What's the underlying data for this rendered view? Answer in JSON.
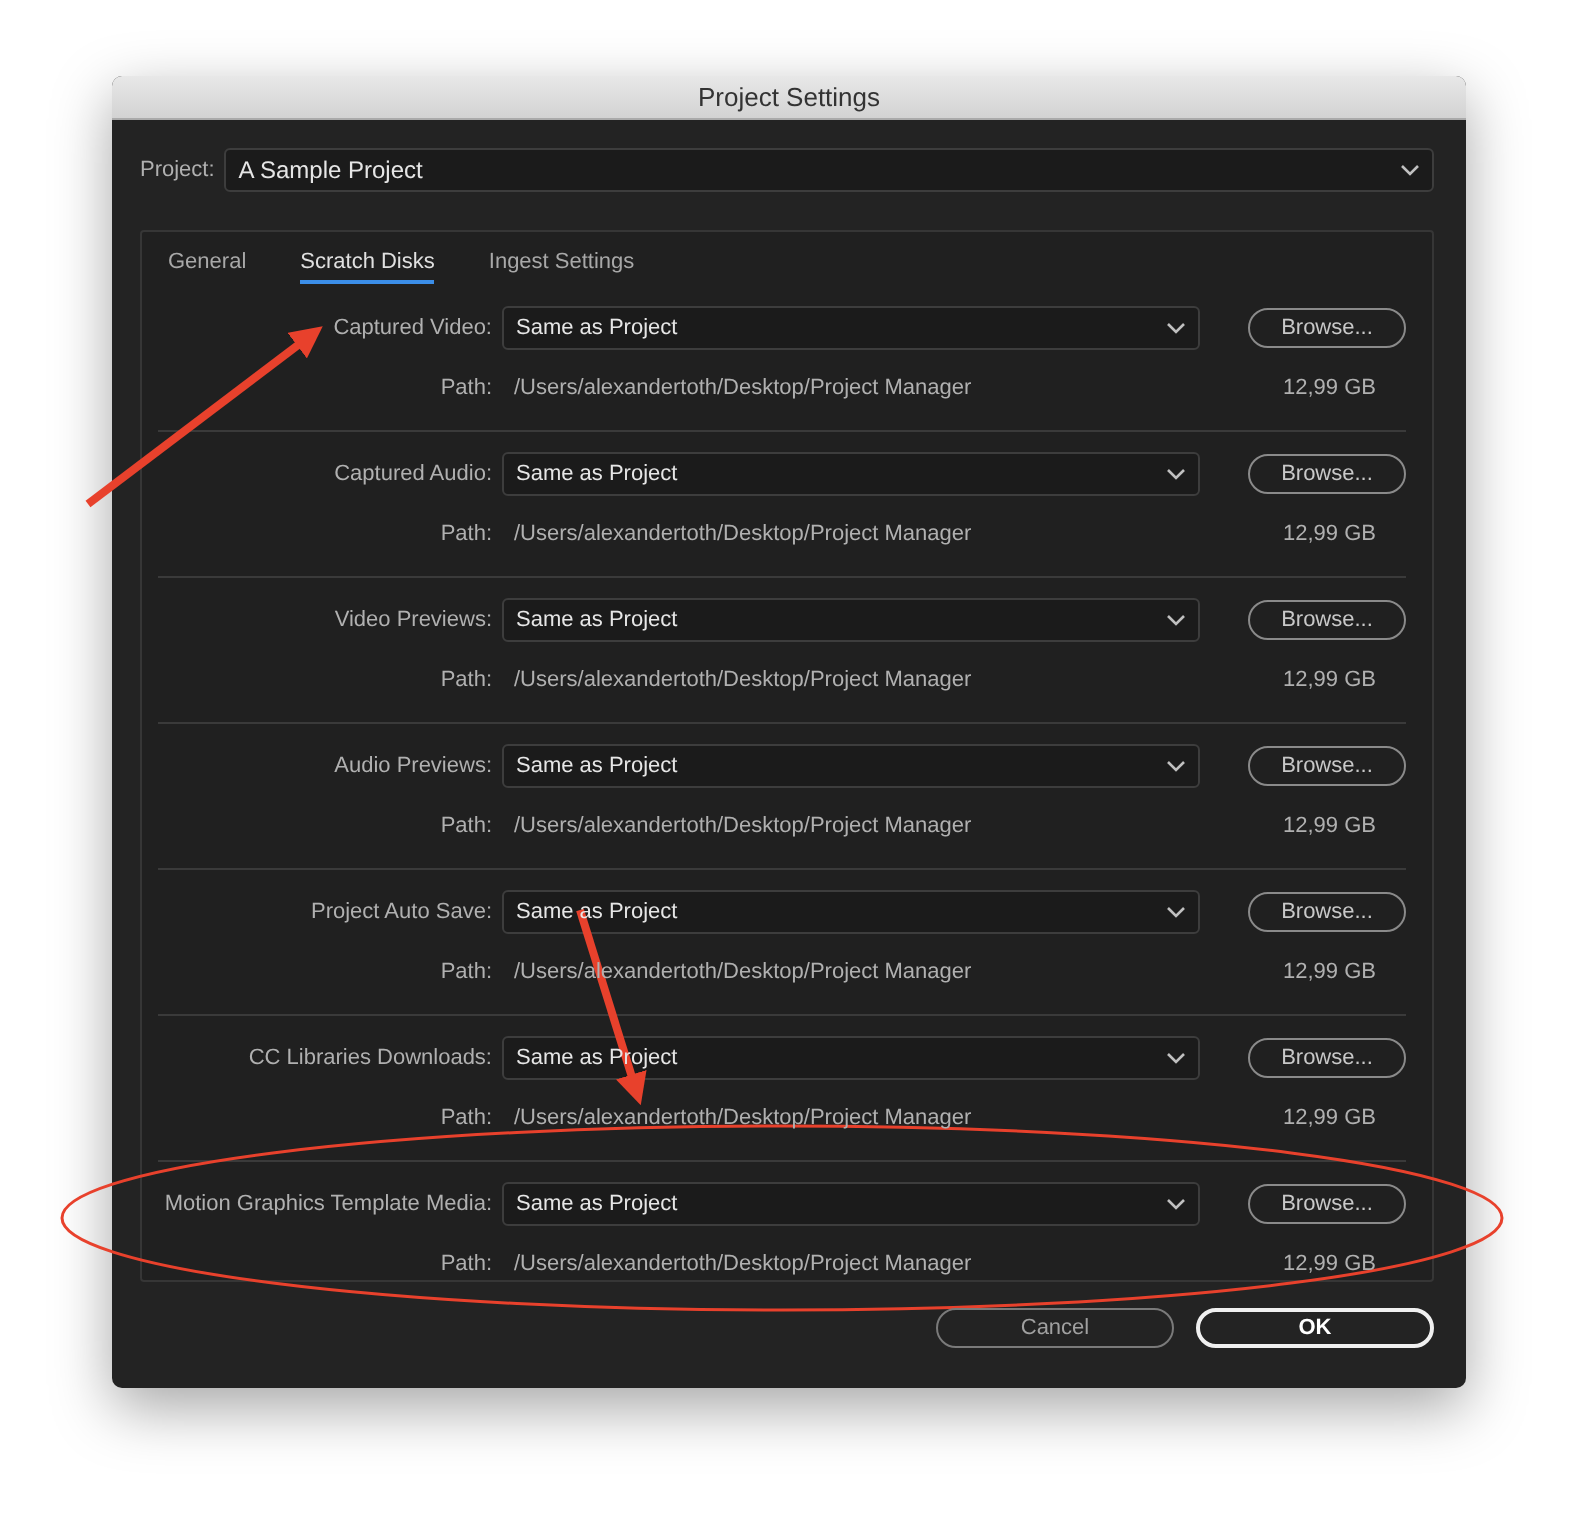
{
  "window": {
    "title": "Project Settings"
  },
  "project": {
    "label": "Project:",
    "value": "A Sample Project"
  },
  "tabs": [
    {
      "label": "General",
      "selected": false
    },
    {
      "label": "Scratch Disks",
      "selected": true
    },
    {
      "label": "Ingest Settings",
      "selected": false
    }
  ],
  "rows": [
    {
      "label": "Captured Video:",
      "value": "Same as Project",
      "button": "Browse...",
      "path_label": "Path:",
      "path": "/Users/alexandertoth/Desktop/Project Manager",
      "size": "12,99 GB"
    },
    {
      "label": "Captured Audio:",
      "value": "Same as Project",
      "button": "Browse...",
      "path_label": "Path:",
      "path": "/Users/alexandertoth/Desktop/Project Manager",
      "size": "12,99 GB"
    },
    {
      "label": "Video Previews:",
      "value": "Same as Project",
      "button": "Browse...",
      "path_label": "Path:",
      "path": "/Users/alexandertoth/Desktop/Project Manager",
      "size": "12,99 GB"
    },
    {
      "label": "Audio Previews:",
      "value": "Same as Project",
      "button": "Browse...",
      "path_label": "Path:",
      "path": "/Users/alexandertoth/Desktop/Project Manager",
      "size": "12,99 GB"
    },
    {
      "label": "Project Auto Save:",
      "value": "Same as Project",
      "button": "Browse...",
      "path_label": "Path:",
      "path": "/Users/alexandertoth/Desktop/Project Manager",
      "size": "12,99 GB"
    },
    {
      "label": "CC Libraries Downloads:",
      "value": "Same as Project",
      "button": "Browse...",
      "path_label": "Path:",
      "path": "/Users/alexandertoth/Desktop/Project Manager",
      "size": "12,99 GB"
    },
    {
      "label": "Motion Graphics Template Media:",
      "value": "Same as Project",
      "button": "Browse...",
      "path_label": "Path:",
      "path": "/Users/alexandertoth/Desktop/Project Manager",
      "size": "12,99 GB"
    }
  ],
  "buttons": [
    {
      "label": "Cancel",
      "kind": "secondary"
    },
    {
      "label": "OK",
      "kind": "primary"
    }
  ]
}
